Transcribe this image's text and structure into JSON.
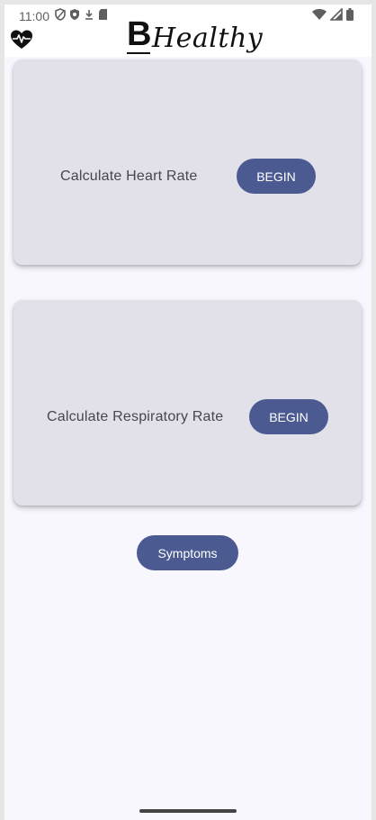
{
  "status_bar": {
    "time": "11:00",
    "left_icons": [
      "shield-icon",
      "shield-filled-icon",
      "download-icon",
      "sd-card-icon"
    ],
    "right_icons": [
      "wifi-icon",
      "signal-icon",
      "battery-icon"
    ]
  },
  "app_bar": {
    "logo_letter": "B",
    "logo_word": "Healthy",
    "icon": "heart-pulse-icon"
  },
  "cards": [
    {
      "label": "Calculate Heart Rate",
      "button": "BEGIN"
    },
    {
      "label": "Calculate Respiratory Rate",
      "button": "BEGIN"
    }
  ],
  "symptoms_button": "Symptoms",
  "colors": {
    "primary": "#4b5b92",
    "card": "#e2e1ea",
    "background": "#f8f7fd"
  }
}
